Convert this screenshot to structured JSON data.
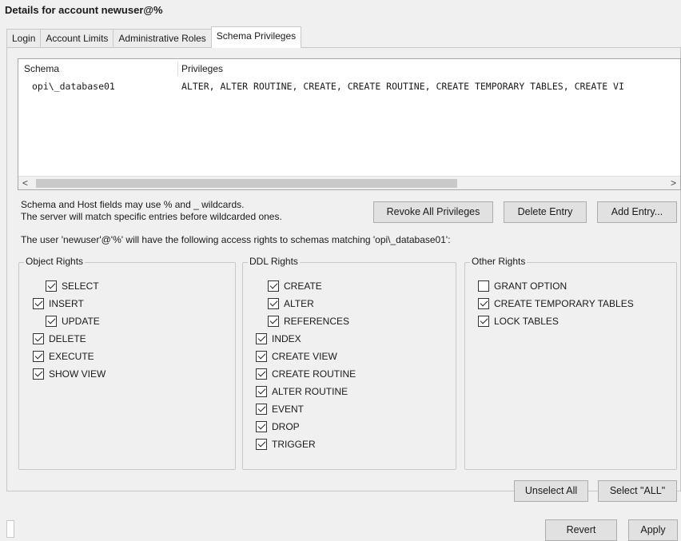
{
  "window": {
    "title": "Details for account newuser@%"
  },
  "tabs": [
    {
      "label": "Login"
    },
    {
      "label": "Account Limits"
    },
    {
      "label": "Administrative Roles"
    },
    {
      "label": "Schema Privileges"
    }
  ],
  "grid": {
    "columns": [
      "Schema",
      "Privileges"
    ],
    "rows": [
      {
        "schema": "opi\\_database01",
        "privileges": "ALTER, ALTER ROUTINE, CREATE, CREATE ROUTINE, CREATE TEMPORARY TABLES, CREATE VI"
      }
    ],
    "scroll_left": "<",
    "scroll_right": ">"
  },
  "hint": {
    "line1": "Schema and Host fields may use % and _ wildcards.",
    "line2": "The server will match specific entries before wildcarded ones."
  },
  "buttons": {
    "revoke_all": "Revoke All Privileges",
    "delete_entry": "Delete Entry",
    "add_entry": "Add Entry...",
    "unselect_all": "Unselect All",
    "select_all": "Select \"ALL\"",
    "revert": "Revert",
    "apply": "Apply"
  },
  "access_text": "The user 'newuser'@'%' will have the following access rights to schemas matching 'opi\\_database01':",
  "object_rights": {
    "title": "Object Rights",
    "items": [
      {
        "label": "SELECT",
        "checked": true
      },
      {
        "label": "INSERT",
        "checked": true
      },
      {
        "label": "UPDATE",
        "checked": true
      },
      {
        "label": "DELETE",
        "checked": true
      },
      {
        "label": "EXECUTE",
        "checked": true
      },
      {
        "label": "SHOW VIEW",
        "checked": true
      }
    ]
  },
  "ddl_rights": {
    "title": "DDL Rights",
    "items": [
      {
        "label": "CREATE",
        "checked": true
      },
      {
        "label": "ALTER",
        "checked": true
      },
      {
        "label": "REFERENCES",
        "checked": true
      },
      {
        "label": "INDEX",
        "checked": true
      },
      {
        "label": "CREATE VIEW",
        "checked": true
      },
      {
        "label": "CREATE ROUTINE",
        "checked": true
      },
      {
        "label": "ALTER ROUTINE",
        "checked": true
      },
      {
        "label": "EVENT",
        "checked": true
      },
      {
        "label": "DROP",
        "checked": true
      },
      {
        "label": "TRIGGER",
        "checked": true
      }
    ]
  },
  "other_rights": {
    "title": "Other Rights",
    "items": [
      {
        "label": "GRANT OPTION",
        "checked": false
      },
      {
        "label": "CREATE TEMPORARY TABLES",
        "checked": true
      },
      {
        "label": "LOCK TABLES",
        "checked": true
      }
    ]
  }
}
